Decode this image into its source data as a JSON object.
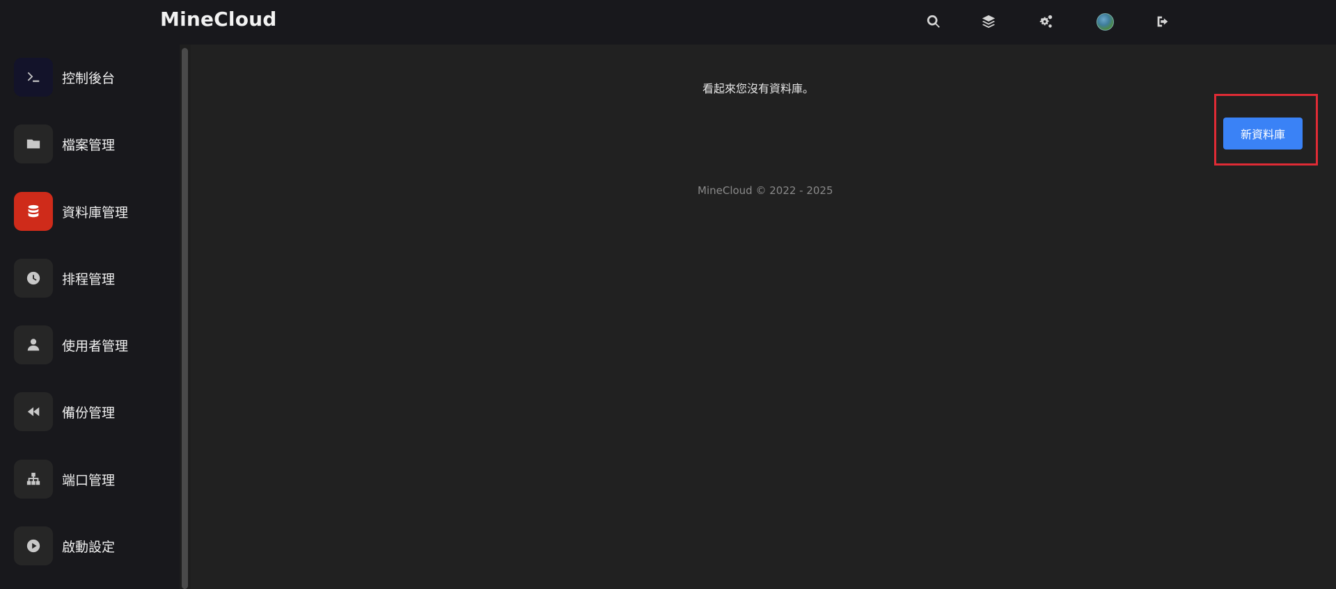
{
  "header": {
    "brand": "MineCloud",
    "icons": [
      "search-icon",
      "layers-icon",
      "gears-icon",
      "avatar",
      "logout-icon"
    ]
  },
  "sidebar": {
    "items": [
      {
        "label": "控制後台",
        "icon": "terminal-icon"
      },
      {
        "label": "檔案管理",
        "icon": "folder-icon"
      },
      {
        "label": "資料庫管理",
        "icon": "database-icon",
        "active": true
      },
      {
        "label": "排程管理",
        "icon": "clock-icon"
      },
      {
        "label": "使用者管理",
        "icon": "user-icon"
      },
      {
        "label": "備份管理",
        "icon": "backward-icon"
      },
      {
        "label": "端口管理",
        "icon": "network-icon"
      },
      {
        "label": "啟動設定",
        "icon": "play-icon"
      }
    ]
  },
  "main": {
    "empty_message": "看起來您沒有資料庫。",
    "new_database_label": "新資料庫",
    "footer": "MineCloud © 2022 - 2025"
  },
  "colors": {
    "accent": "#3a82f6",
    "active_nav": "#cf2b1a",
    "highlight": "#e02b35"
  }
}
